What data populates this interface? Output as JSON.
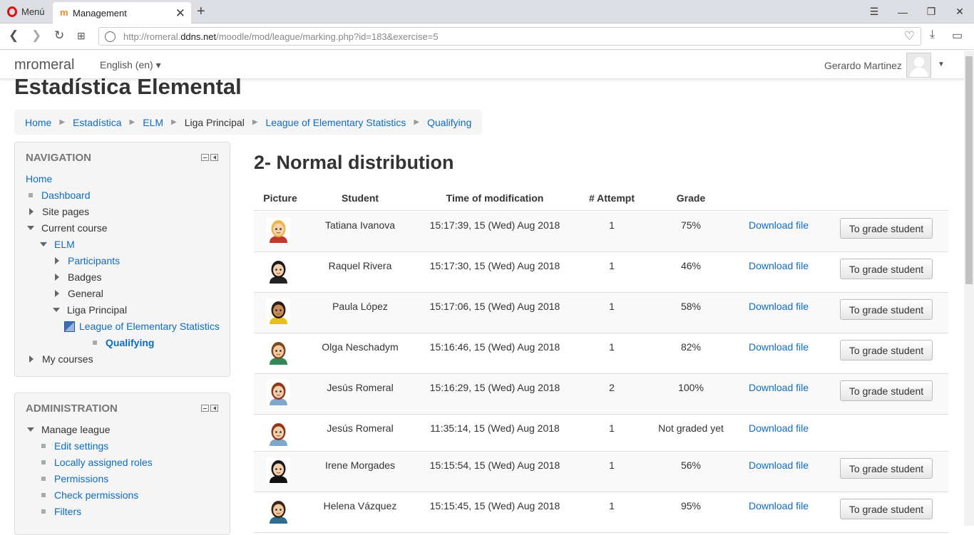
{
  "browser": {
    "menu_label": "Menú",
    "tab_title": "Management",
    "url_prefix": "http://romeral.",
    "url_domain": "ddns.net",
    "url_path": "/moodle/mod/league/marking.php?id=183&exercise=5"
  },
  "navbar": {
    "brand": "mromeral",
    "language": "English (en) ▾",
    "user_name": "Gerardo Martinez"
  },
  "page": {
    "title": "Estadística Elemental",
    "breadcrumb": [
      "Home",
      "Estadística",
      "ELM",
      "Liga Principal",
      "League of Elementary Statistics",
      "Qualifying"
    ]
  },
  "navigation": {
    "title": "NAVIGATION",
    "items": {
      "home": "Home",
      "dashboard": "Dashboard",
      "site_pages": "Site pages",
      "current_course": "Current course",
      "elm": "ELM",
      "participants": "Participants",
      "badges": "Badges",
      "general": "General",
      "liga": "Liga Principal",
      "league": "League of Elementary Statistics",
      "qualifying": "Qualifying",
      "my_courses": "My courses"
    }
  },
  "administration": {
    "title": "ADMINISTRATION",
    "items": {
      "manage": "Manage league",
      "edit": "Edit settings",
      "roles": "Locally assigned roles",
      "permissions": "Permissions",
      "check": "Check permissions",
      "filters": "Filters"
    }
  },
  "main": {
    "heading": "2- Normal distribution",
    "columns": [
      "Picture",
      "Student",
      "Time of modification",
      "# Attempt",
      "Grade"
    ],
    "download_label": "Download file",
    "grade_button_label": "To grade student",
    "rows": [
      {
        "student": "Tatiana Ivanova",
        "time": "15:17:39, 15 (Wed) Aug 2018",
        "attempt": "1",
        "grade": "75%",
        "hair": "#e8b84a",
        "shirt": "#c0392b",
        "skin": "#f5d0a9"
      },
      {
        "student": "Raquel Rivera",
        "time": "15:17:30, 15 (Wed) Aug 2018",
        "attempt": "1",
        "grade": "46%",
        "hair": "#1a1a1a",
        "shirt": "#222222",
        "skin": "#f3cfae"
      },
      {
        "student": "Paula López",
        "time": "15:17:06, 15 (Wed) Aug 2018",
        "attempt": "1",
        "grade": "58%",
        "hair": "#2b1d12",
        "shirt": "#e6c11b",
        "skin": "#c98b5a"
      },
      {
        "student": "Olga Neschadym",
        "time": "15:16:46, 15 (Wed) Aug 2018",
        "attempt": "1",
        "grade": "82%",
        "hair": "#7a4a22",
        "shirt": "#2e8b57",
        "skin": "#f1c9a1"
      },
      {
        "student": "Jesús Romeral",
        "time": "15:16:29, 15 (Wed) Aug 2018",
        "attempt": "2",
        "grade": "100%",
        "hair": "#8b3a1e",
        "shirt": "#7fa7c9",
        "skin": "#f2cfad"
      },
      {
        "student": "Jesús Romeral",
        "time": "11:35:14, 15 (Wed) Aug 2018",
        "attempt": "1",
        "grade": "Not graded yet",
        "hair": "#8b3a1e",
        "shirt": "#7fa7c9",
        "skin": "#f2cfad"
      },
      {
        "student": "Irene Morgades",
        "time": "15:15:54, 15 (Wed) Aug 2018",
        "attempt": "1",
        "grade": "56%",
        "hair": "#1a1a1a",
        "shirt": "#111111",
        "skin": "#f3cfae"
      },
      {
        "student": "Helena Vázquez",
        "time": "15:15:45, 15 (Wed) Aug 2018",
        "attempt": "1",
        "grade": "95%",
        "hair": "#3a2414",
        "shirt": "#2a6f8f",
        "skin": "#f1c9a1"
      }
    ]
  }
}
